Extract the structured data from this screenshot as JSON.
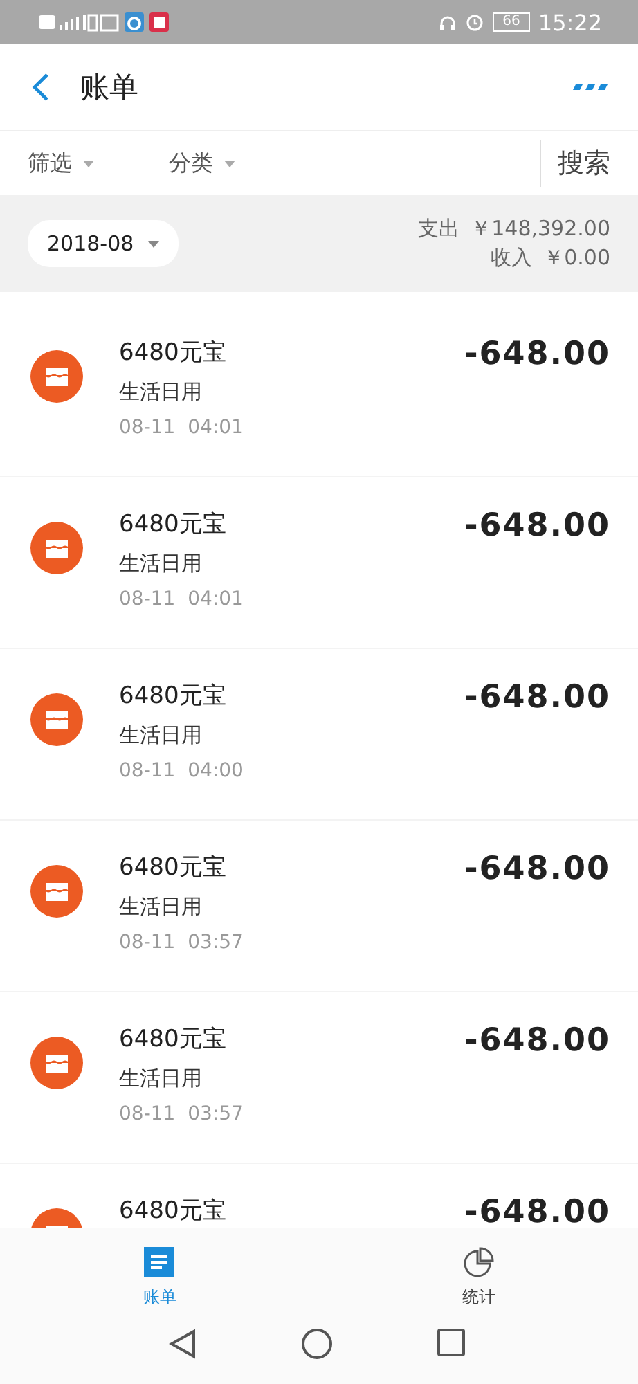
{
  "status_bar": {
    "battery": "66",
    "time": "15:22"
  },
  "header": {
    "title": "账单"
  },
  "filters": [
    {
      "label": "筛选"
    },
    {
      "label": "分类"
    }
  ],
  "search": "搜索",
  "summary": {
    "month": "2018-08",
    "expense_label": "支出",
    "expense": "￥148,392.00",
    "income_label": "收入",
    "income": "￥0.00"
  },
  "transactions": [
    {
      "title": "6480元宝",
      "category": "生活日用",
      "date": "08-11",
      "time": "04:01",
      "amount": "-648.00"
    },
    {
      "title": "6480元宝",
      "category": "生活日用",
      "date": "08-11",
      "time": "04:01",
      "amount": "-648.00"
    },
    {
      "title": "6480元宝",
      "category": "生活日用",
      "date": "08-11",
      "time": "04:00",
      "amount": "-648.00"
    },
    {
      "title": "6480元宝",
      "category": "生活日用",
      "date": "08-11",
      "time": "03:57",
      "amount": "-648.00"
    },
    {
      "title": "6480元宝",
      "category": "生活日用",
      "date": "08-11",
      "time": "03:57",
      "amount": "-648.00"
    },
    {
      "title": "6480元宝",
      "amount": "-648.00"
    }
  ],
  "tabs": [
    {
      "label": "账单",
      "kind": "bill",
      "selected": true
    },
    {
      "label": "统计",
      "kind": "stats",
      "selected": false
    }
  ]
}
